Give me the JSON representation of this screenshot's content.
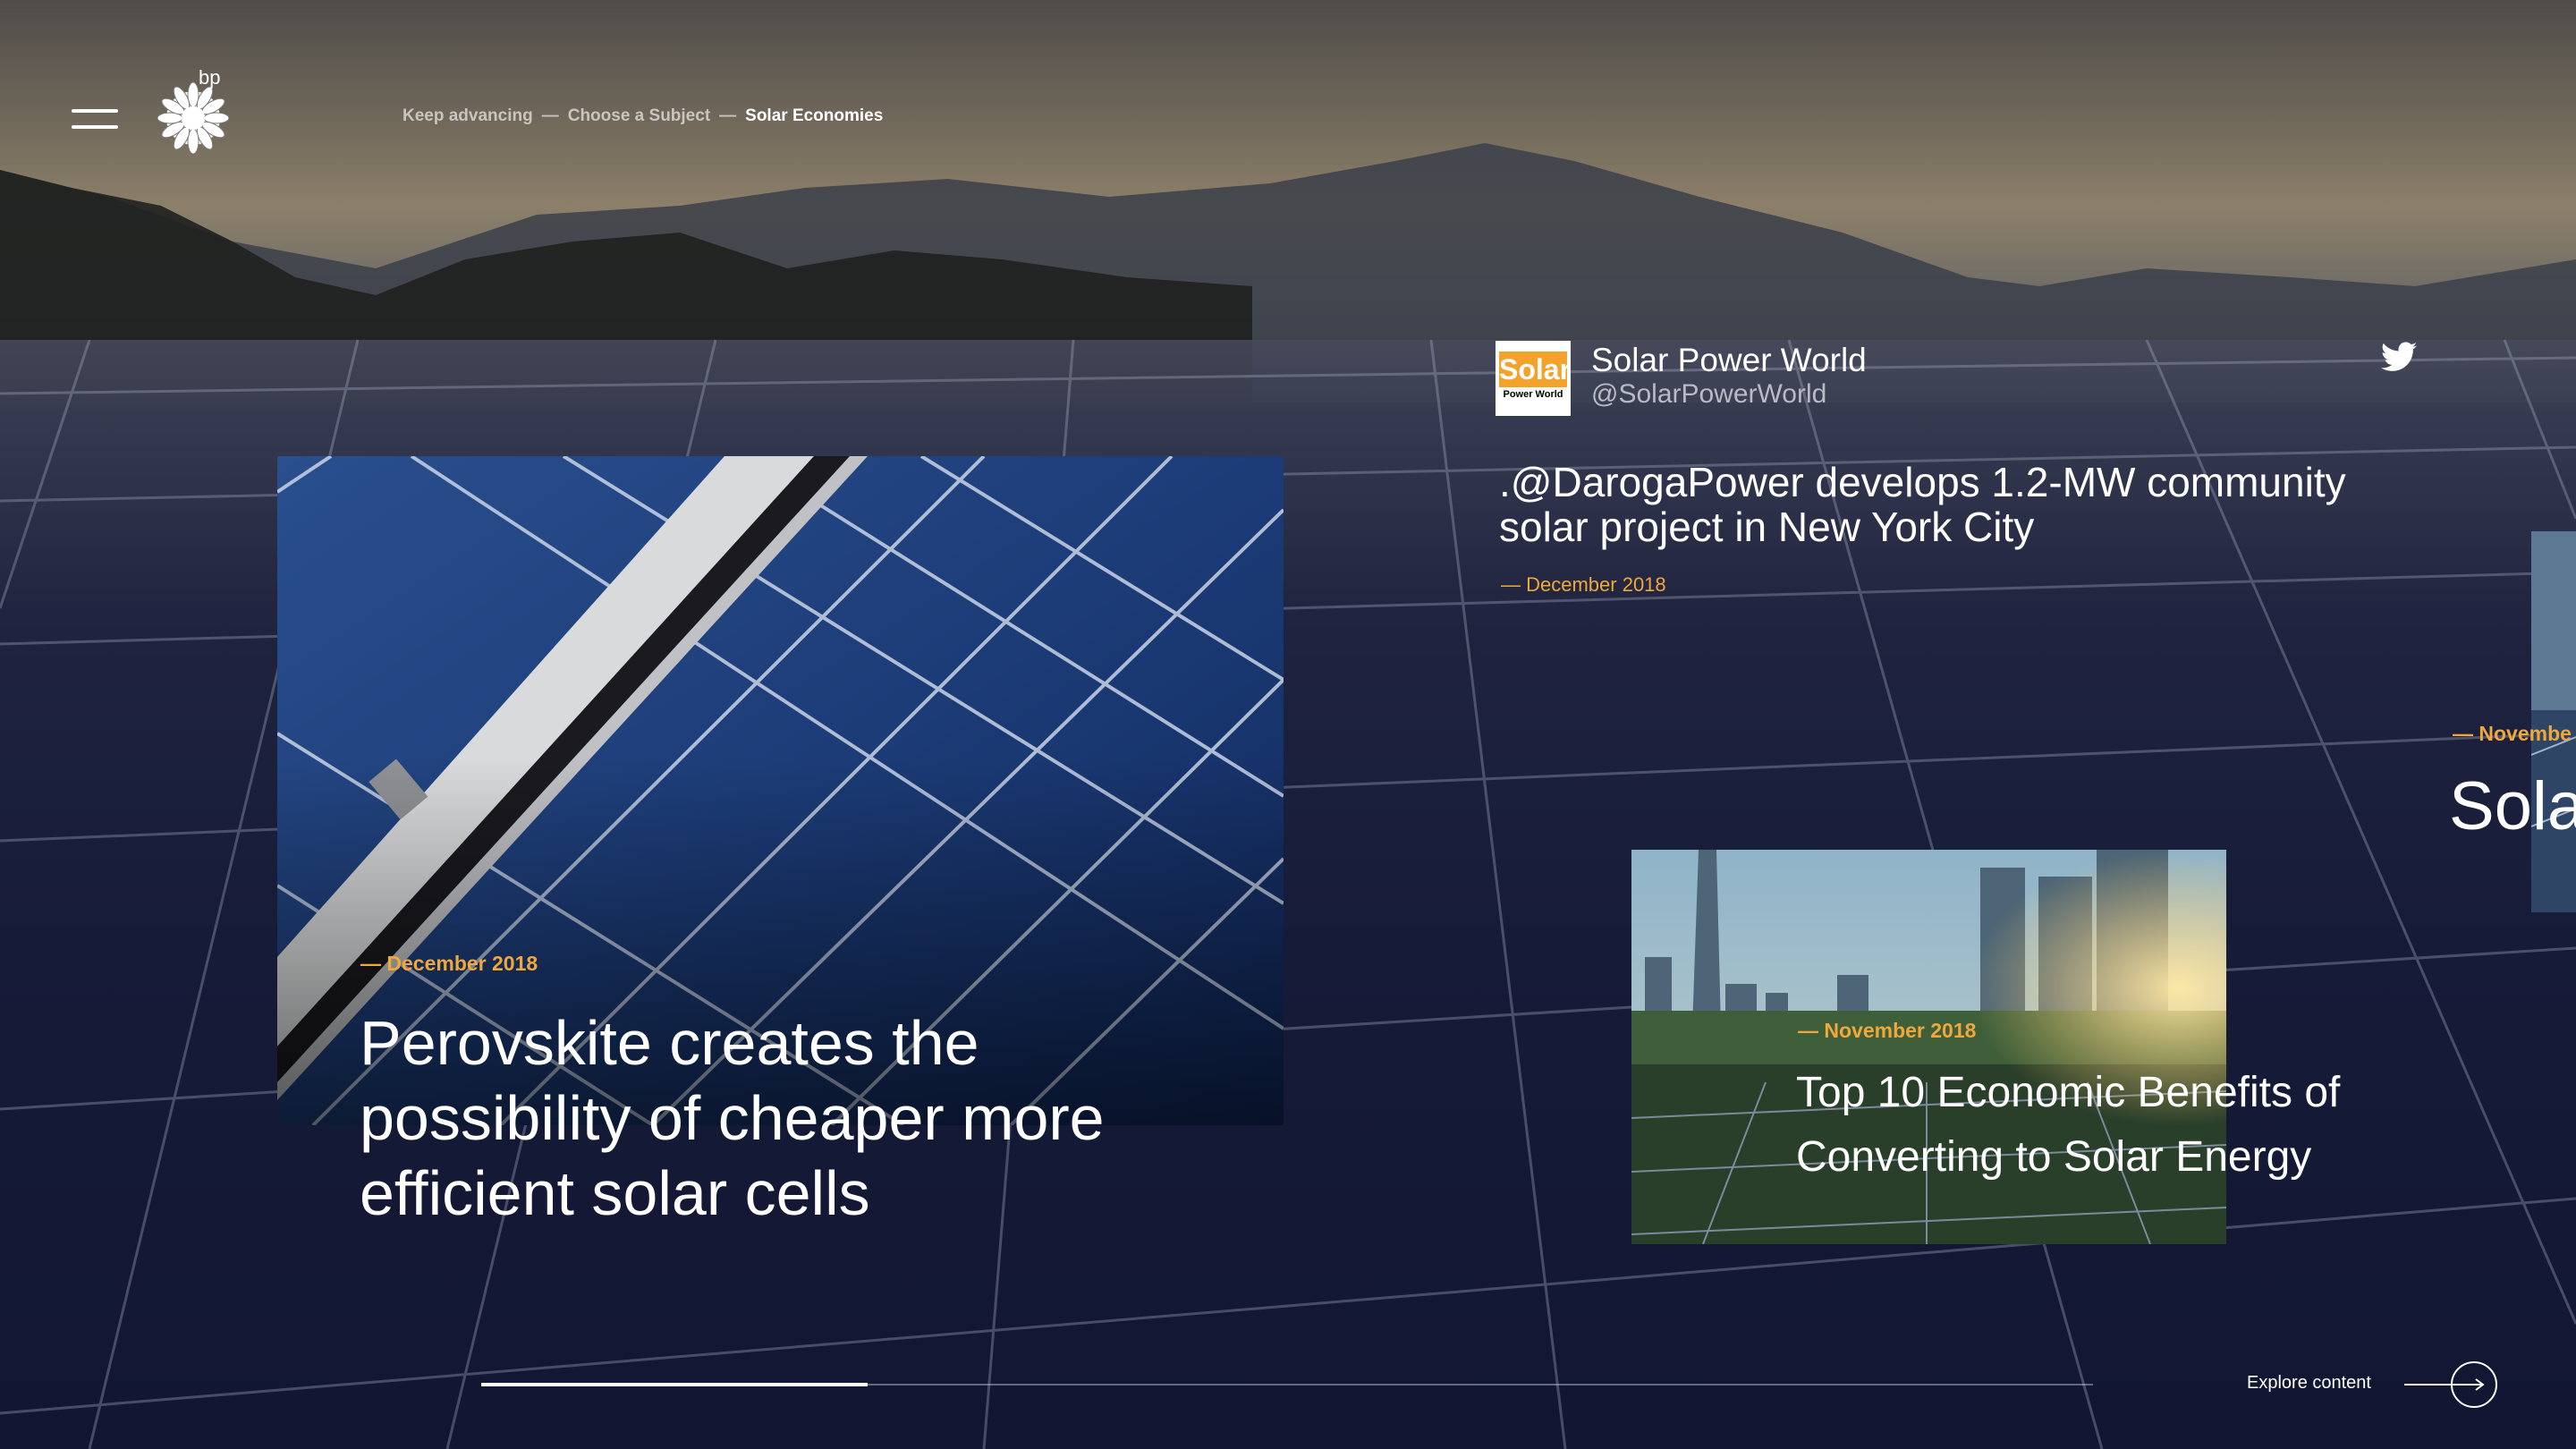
{
  "header": {
    "logo_text": "bp",
    "breadcrumb": [
      "Keep advancing",
      "Choose a Subject",
      "Solar Economies"
    ],
    "separator": "—"
  },
  "main_card": {
    "date": "— December 2018",
    "title": "Perovskite creates the possibility of cheaper more efficient solar cells"
  },
  "tweet": {
    "logo_word": "Solar",
    "logo_sub": "Power World",
    "name": "Solar Power World",
    "handle": "@SolarPowerWorld",
    "text": ".@DarogaPower develops 1.2-MW community solar project in New York City",
    "date": "— December 2018",
    "icon": "twitter-icon"
  },
  "secondary_card": {
    "date": "— November 2018",
    "title": "Top 10 Economic Benefits of Converting to Solar Energy"
  },
  "peek_card": {
    "date": "— Novembe",
    "title": "Sola"
  },
  "footer": {
    "explore_label": "Explore content",
    "progress": 0.24
  },
  "colors": {
    "accent": "#f0a83a",
    "background": "#161b33"
  }
}
